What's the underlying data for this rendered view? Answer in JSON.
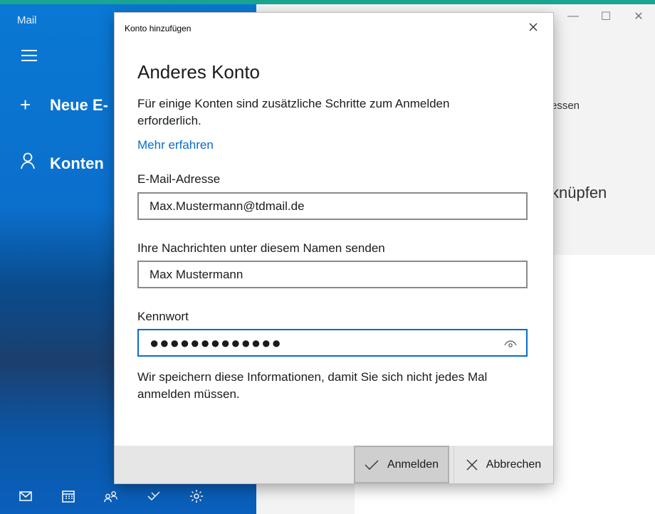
{
  "app": {
    "title": "Mail",
    "new_mail_label": "Neue E-",
    "accounts_label": "Konten",
    "peek_text_1": "essen",
    "peek_text_2": "knüpfen",
    "window_controls": [
      "—",
      "☐",
      "✕"
    ]
  },
  "dialog": {
    "window_title": "Konto hinzufügen",
    "heading": "Anderes Konto",
    "description": "Für einige Konten sind zusätzliche Schritte zum Anmelden erforderlich.",
    "learn_more_link": "Mehr erfahren",
    "email": {
      "label": "E-Mail-Adresse",
      "value": "Max.Mustermann@tdmail.de"
    },
    "sender_name": {
      "label": "Ihre Nachrichten unter diesem Namen senden",
      "value": "Max Mustermann"
    },
    "password": {
      "label": "Kennwort",
      "masked_value": "●●●●●●●●●●●●●"
    },
    "note": "Wir speichern diese Informationen, damit Sie sich nicht jedes Mal anmelden müssen.",
    "sign_in_button": "Anmelden",
    "cancel_button": "Abbrechen"
  },
  "colors": {
    "accent": "#0a6ccf",
    "sidebar_blue": "#0a78d4",
    "teal_desktop": "#1aa592"
  },
  "icons": [
    "hamburger-icon",
    "plus-icon",
    "person-icon",
    "close-icon",
    "eye-icon",
    "checkmark-icon",
    "mail-icon",
    "calendar-icon",
    "people-icon",
    "todo-icon",
    "gear-icon"
  ]
}
